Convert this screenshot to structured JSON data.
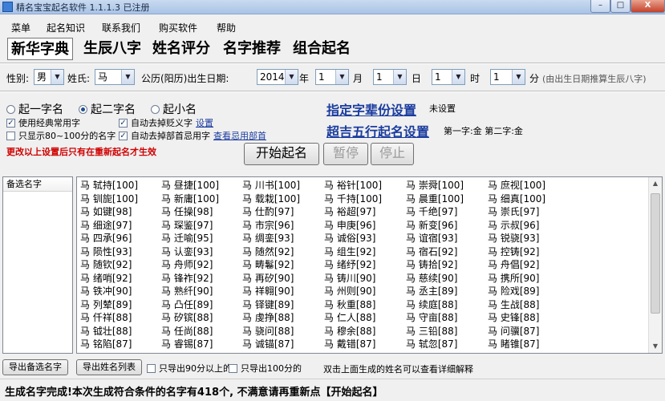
{
  "window": {
    "title": "精名宝宝起名软件 1.1.1.3 已注册",
    "min_label": "–",
    "max_label": "□",
    "close_label": "X"
  },
  "menu": [
    "菜单",
    "起名知识",
    "联系我们",
    "购买软件",
    "帮助"
  ],
  "tabs": [
    "新华字典",
    "生辰八字",
    "姓名评分",
    "名字推荐",
    "组合起名"
  ],
  "form": {
    "gender_label": "性别:",
    "gender_value": "男",
    "surname_label": "姓氏:",
    "surname_value": "马",
    "birth_label": "公历(阳历)出生日期:",
    "year_value": "2014",
    "year_unit": "年",
    "month_value": "1",
    "month_unit": "月",
    "day_value": "1",
    "day_unit": "日",
    "hour_value": "1",
    "hour_unit": "时",
    "minute_value": "1",
    "minute_unit": "分",
    "hint": "(由出生日期推算生辰八字)"
  },
  "options": {
    "radio_one": "起一字名",
    "radio_two": "起二字名",
    "radio_nick": "起小名",
    "cb_common": "使用经典常用字",
    "cb_score": "只显示80~100分的名字",
    "cb_avoid": "自动去掉贬义字",
    "cb_avoid_link": "设置",
    "cb_tail": "自动去掉部首忌用字",
    "cb_tail_link": "查看忌用部首",
    "generation_link": "指定字辈份设置",
    "generation_status": "未设置",
    "wuxing_link": "超吉五行起名设置",
    "wuxing_status": "第一字:金  第二字:金",
    "warning": "更改以上设置后只有在重新起名才生效"
  },
  "buttons": {
    "start": "开始起名",
    "pause": "暂停",
    "stop": "停止",
    "export_selected": "导出备选名字",
    "export_list": "导出姓名列表",
    "export_90": "只导出90分以上的",
    "export_100": "只导出100分的",
    "dblclick_hint": "双击上面生成的姓名可以查看详细解释"
  },
  "side_panel": {
    "header": "备选名字"
  },
  "names": [
    [
      "马 轼持[100]",
      "马 钏旎[100]",
      "马 如键[98]",
      "马 细途[97]",
      "马 四承[96]",
      "马 陨性[93]",
      "马 随钦[92]",
      "马 绪哨[92]",
      "马 铁冲[90]",
      "马 列辇[89]",
      "马 仟祥[88]",
      "马 钺壮[88]",
      "马 铭陷[87]"
    ],
    [
      "马 昼捷[100]",
      "马 新庸[100]",
      "马 任操[98]",
      "马 琛鉴[97]",
      "马 迁喻[95]",
      "马 认銮[93]",
      "马 舟师[92]",
      "马 锋祚[92]",
      "马 熟纤[90]",
      "马 凸任[89]",
      "马 矽镔[88]",
      "马 任尚[88]",
      "马 睿锡[87]"
    ],
    [
      "马 川书[100]",
      "马 载栽[100]",
      "马 仕酌[97]",
      "马 市宗[96]",
      "马 绸銮[93]",
      "马 随然[92]",
      "马 畴鬈[92]",
      "马 再矽[90]",
      "马 祥翱[90]",
      "马 铎键[89]",
      "马 虔挣[88]",
      "马 骁问[88]",
      "马 诚锚[87]"
    ],
    [
      "马 裕针[100]",
      "马 千持[100]",
      "马 裕超[97]",
      "马 申庚[96]",
      "马 诚俗[93]",
      "马 组生[92]",
      "马 绪纾[92]",
      "马 铸川[90]",
      "马 州则[90]",
      "马 秋重[88]",
      "马 仁人[88]",
      "马 穆余[88]",
      "马 戴错[87]"
    ],
    [
      "马 崇舜[100]",
      "马 晨重[100]",
      "马 千绝[97]",
      "马 新变[96]",
      "马 谊宿[93]",
      "马 宿石[92]",
      "马 铸拾[92]",
      "马 慈续[90]",
      "马 丞主[89]",
      "马 续庭[88]",
      "马 守亩[88]",
      "马 三铅[88]",
      "马 轼忽[87]"
    ],
    [
      "马 庶视[100]",
      "马 细真[100]",
      "马 崇氏[97]",
      "马 示叔[96]",
      "马 锐骁[93]",
      "马 控铸[92]",
      "马 舟倡[92]",
      "马 携所[90]",
      "马 险戏[89]",
      "马 生战[88]",
      "马 史锋[88]",
      "马 问骥[87]",
      "马 睹锥[87]"
    ]
  ],
  "status_text": "生成名字完成!本次生成符合条件的名字有418个, 不满意请再重新点【开始起名】"
}
